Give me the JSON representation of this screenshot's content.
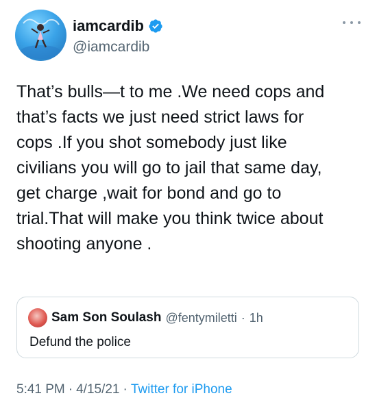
{
  "author": {
    "display_name": "iamcardib",
    "handle": "@iamcardib"
  },
  "tweet": {
    "text": "That’s bulls—t to me .We need cops and\nthat’s facts we just need strict laws for\ncops .If you shot somebody just like\ncivilians you will go to jail that same day,\nget charge ,wait for bond and go to\ntrial.That will make you think twice about\nshooting anyone ."
  },
  "quoted_tweet": {
    "name": "Sam Son Soulash",
    "handle": "@fentymiletti",
    "dot": "·",
    "time": "1h",
    "text": "Defund the police"
  },
  "meta": {
    "time": "5:41 PM",
    "sep1": "·",
    "date": "4/15/21",
    "sep2": "·",
    "source": "Twitter for iPhone"
  },
  "colors": {
    "verified": "#1d9bf0",
    "link": "#1d9bf0",
    "secondary_text": "#536471"
  },
  "icons": {
    "verified": "verified-badge-icon",
    "more": "more-options-icon"
  }
}
